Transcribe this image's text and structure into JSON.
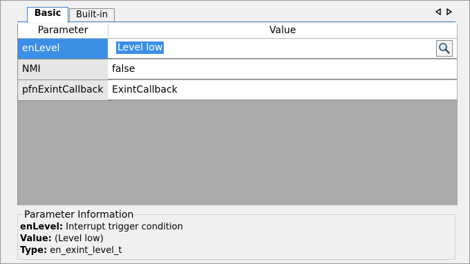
{
  "tabs": [
    {
      "label": "Basic",
      "active": true
    },
    {
      "label": "Built-in",
      "active": false
    }
  ],
  "grid": {
    "header": {
      "parameter": "Parameter",
      "value": "Value"
    },
    "rows": [
      {
        "parameter": "enLevel",
        "value": "Level low",
        "selected": true
      },
      {
        "parameter": "NMI",
        "value": "false",
        "selected": false
      },
      {
        "parameter": "pfnExintCallback",
        "value": "ExintCallback",
        "selected": false
      }
    ]
  },
  "info": {
    "title": "Parameter Information",
    "name_label": "enLevel:",
    "name_desc": "Interrupt trigger condition",
    "value_label": "Value:",
    "value_text": "(Level low)",
    "type_label": "Type:",
    "type_text": "en_exint_level_t"
  },
  "icons": {
    "search": "magnifier-icon",
    "nav_left": "triangle-left-icon",
    "nav_right": "triangle-right-icon"
  },
  "colors": {
    "selection": "#3c8fe6",
    "tab_accent": "#3f7fc1",
    "empty_area": "#ababab"
  }
}
